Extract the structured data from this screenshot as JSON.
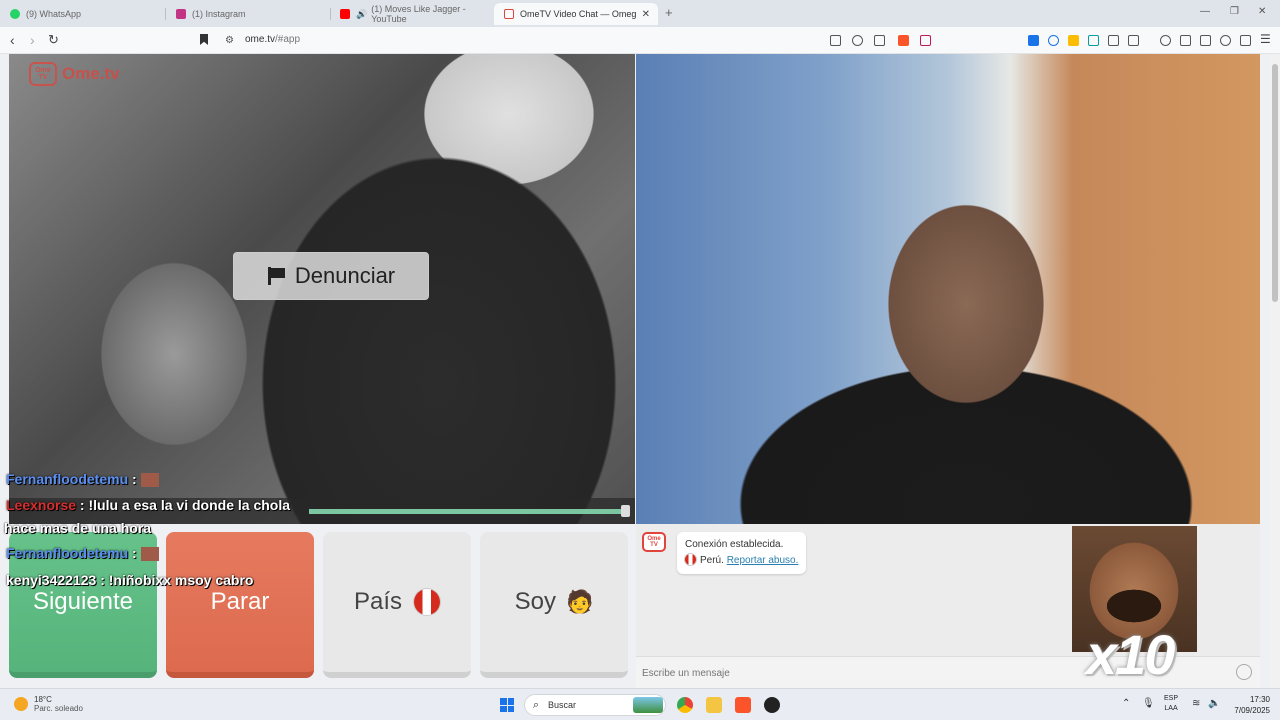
{
  "browser": {
    "tabs": [
      {
        "title": "(9) WhatsApp",
        "color": "#25D366"
      },
      {
        "title": "(1) Instagram",
        "color": "#C13584"
      },
      {
        "title": "(1) Moves Like Jagger - YouTube",
        "color": "#FF0000"
      },
      {
        "title": "OmeTV Video Chat — Omeg",
        "color": "#E0443C"
      }
    ],
    "new_tab": "+",
    "url_host": "ome.tv",
    "url_path": "/#app"
  },
  "video": {
    "logo_box": "Ome TV",
    "logo_text": "Ome.tv",
    "report_label": "Denunciar"
  },
  "overlay_chat": [
    {
      "name": "Fernanfloodetemu",
      "sep": " :",
      "msg": ""
    },
    {
      "name": "Leexnorse",
      "sep": " : ",
      "msg": "!lulu a esa la vi donde la chola"
    },
    {
      "name": "",
      "sep": "",
      "msg": "hace mas de una hora"
    },
    {
      "name": "Fernanfloodetemu",
      "sep": " :",
      "msg": ""
    },
    {
      "name": "kenyi3422123",
      "sep": " : ",
      "msg": "!niñobixx msoy cabro"
    }
  ],
  "buttons": {
    "next": "Siguiente",
    "stop": "Parar",
    "country": "País",
    "iam": "Soy",
    "iam_emoji": "🧑"
  },
  "chat": {
    "bot_logo": "Ome TV",
    "status": "Conexión establecida.",
    "country": "Perú.",
    "report_link": "Reportar abuso.",
    "input_placeholder": "Escribe un mensaje"
  },
  "meme": {
    "caption": "x10"
  },
  "taskbar": {
    "weather_temp": "18°C",
    "weather_desc": "Parc. soleado",
    "search_label": "Buscar",
    "lang_1": "ESP",
    "lang_2": "LAA",
    "time": "17:30",
    "date": "7/09/2025"
  }
}
